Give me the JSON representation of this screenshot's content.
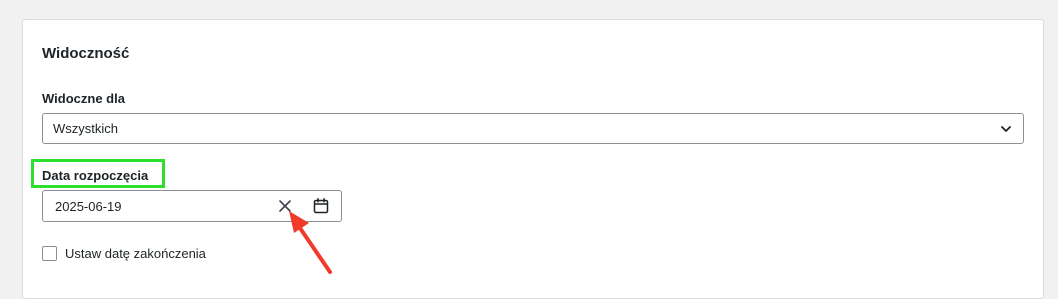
{
  "section": {
    "title": "Widoczność"
  },
  "visibility": {
    "label": "Widoczne dla",
    "selected": "Wszystkich"
  },
  "start_date": {
    "label": "Data rozpoczęcia",
    "value": "2025-06-19",
    "clear_icon": "close-icon",
    "calendar_icon": "calendar-icon"
  },
  "end_date_toggle": {
    "label": "Ustaw datę zakończenia",
    "checked": false
  },
  "annotations": {
    "highlight_color": "#2ee02e",
    "arrow_color": "#f23a2a"
  }
}
